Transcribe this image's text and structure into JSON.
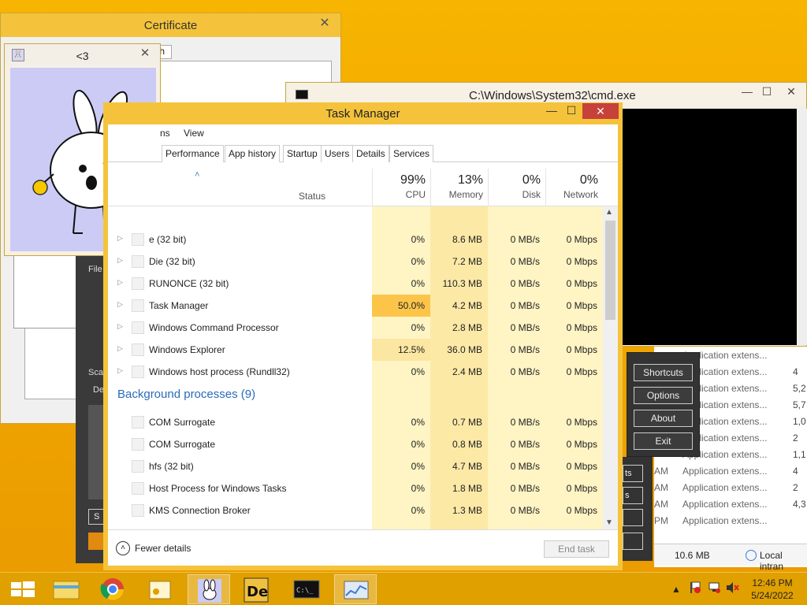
{
  "certificate": {
    "title": "Certificate",
    "close_glyph": "✕",
    "tab_fragment": "th"
  },
  "bunny": {
    "title": "<3",
    "close_glyph": "✕"
  },
  "darkapp": {
    "file_label": "File",
    "sca_label": "Sca",
    "de_label": "De",
    "s_label": "S"
  },
  "cmd": {
    "title": "C:\\Windows\\System32\\cmd.exe",
    "min_glyph": "—",
    "max_glyph": "☐",
    "close_glyph": "✕"
  },
  "shortcut_menu": {
    "items": [
      "Shortcuts",
      "Options",
      "About",
      "Exit"
    ],
    "side_items": [
      "ts",
      "s",
      "",
      ""
    ]
  },
  "right_list": {
    "rows": [
      {
        "time": "",
        "desc": "Application extens...",
        "size": ""
      },
      {
        "time": "",
        "desc": "Application extens...",
        "size": "4"
      },
      {
        "time": "",
        "desc": "Application extens...",
        "size": "5,2"
      },
      {
        "time": "",
        "desc": "Application extens...",
        "size": "5,7"
      },
      {
        "time": "",
        "desc": "Application extens...",
        "size": "1,0"
      },
      {
        "time": "",
        "desc": "Application extens...",
        "size": "2"
      },
      {
        "time": "",
        "desc": "Application extens...",
        "size": "1,1"
      },
      {
        "time": "AM",
        "desc": "Application extens...",
        "size": "4"
      },
      {
        "time": "AM",
        "desc": "Application extens...",
        "size": "2"
      },
      {
        "time": "AM",
        "desc": "Application extens...",
        "size": "4,3"
      },
      {
        "time": "PM",
        "desc": "Application extens...",
        "size": ""
      }
    ],
    "footer_size": "10.6 MB",
    "footer_zone": "Local intran"
  },
  "task_manager": {
    "title": "Task Manager",
    "min_glyph": "—",
    "max_glyph": "☐",
    "close_glyph": "✕",
    "menu": [
      "ns",
      "View"
    ],
    "tabs": [
      "Performance",
      "App history",
      "Startup",
      "Users",
      "Details",
      "Services"
    ],
    "columns": {
      "status": "Status",
      "cpu": {
        "pct": "99%",
        "name": "CPU"
      },
      "memory": {
        "pct": "13%",
        "name": "Memory"
      },
      "disk": {
        "pct": "0%",
        "name": "Disk"
      },
      "network": {
        "pct": "0%",
        "name": "Network"
      }
    },
    "apps": [
      {
        "name": "e (32 bit)",
        "cpu": "0%",
        "mem": "8.6 MB",
        "disk": "0 MB/s",
        "net": "0 Mbps"
      },
      {
        "name": "Die (32 bit)",
        "cpu": "0%",
        "mem": "7.2 MB",
        "disk": "0 MB/s",
        "net": "0 Mbps"
      },
      {
        "name": "RUNONCE (32 bit)",
        "cpu": "0%",
        "mem": "110.3 MB",
        "disk": "0 MB/s",
        "net": "0 Mbps"
      },
      {
        "name": "Task Manager",
        "cpu": "50.0%",
        "mem": "4.2 MB",
        "disk": "0 MB/s",
        "net": "0 Mbps"
      },
      {
        "name": "Windows Command Processor",
        "cpu": "0%",
        "mem": "2.8 MB",
        "disk": "0 MB/s",
        "net": "0 Mbps"
      },
      {
        "name": "Windows Explorer",
        "cpu": "12.5%",
        "mem": "36.0 MB",
        "disk": "0 MB/s",
        "net": "0 Mbps"
      },
      {
        "name": "Windows host process (Rundll32)",
        "cpu": "0%",
        "mem": "2.4 MB",
        "disk": "0 MB/s",
        "net": "0 Mbps"
      }
    ],
    "background_header": "Background processes (9)",
    "background": [
      {
        "name": "COM Surrogate",
        "cpu": "0%",
        "mem": "0.7 MB",
        "disk": "0 MB/s",
        "net": "0 Mbps"
      },
      {
        "name": "COM Surrogate",
        "cpu": "0%",
        "mem": "0.8 MB",
        "disk": "0 MB/s",
        "net": "0 Mbps"
      },
      {
        "name": "hfs (32 bit)",
        "cpu": "0%",
        "mem": "4.7 MB",
        "disk": "0 MB/s",
        "net": "0 Mbps"
      },
      {
        "name": "Host Process for Windows Tasks",
        "cpu": "0%",
        "mem": "1.8 MB",
        "disk": "0 MB/s",
        "net": "0 Mbps"
      },
      {
        "name": "KMS Connection Broker",
        "cpu": "0%",
        "mem": "1.3 MB",
        "disk": "0 MB/s",
        "net": "0 Mbps"
      }
    ],
    "fewer_details": "Fewer details",
    "end_task": "End task"
  },
  "taskbar": {
    "time": "12:46 PM",
    "date": "5/24/2022",
    "items": [
      "start-icon",
      "file-explorer-icon",
      "chrome-icon",
      "certificate-app-icon",
      "bunny-app-icon",
      "die-app-icon",
      "cmd-icon",
      "task-manager-icon"
    ]
  },
  "colors": {
    "accent": "#f5c33b",
    "close_red": "#c7413b",
    "cpu_high": "#fcc54a",
    "cpu_mid": "#fbe6a2",
    "heat_light": "#fff4c4",
    "group_blue": "#2a6ab8"
  }
}
